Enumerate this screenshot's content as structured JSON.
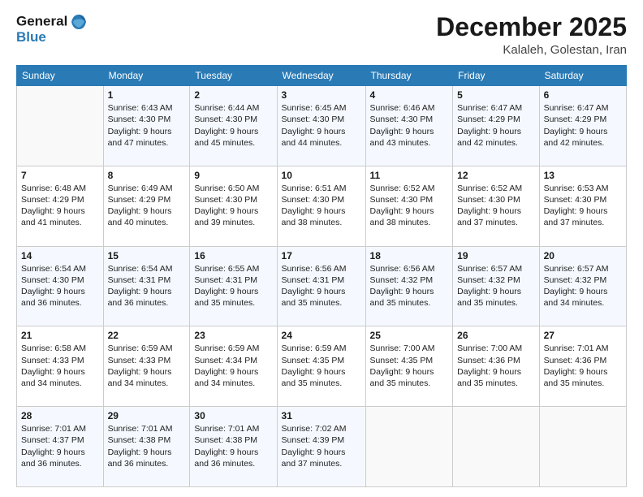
{
  "header": {
    "logo_line1": "General",
    "logo_line2": "Blue",
    "month": "December 2025",
    "location": "Kalaleh, Golestan, Iran"
  },
  "weekdays": [
    "Sunday",
    "Monday",
    "Tuesday",
    "Wednesday",
    "Thursday",
    "Friday",
    "Saturday"
  ],
  "weeks": [
    [
      {
        "day": "",
        "info": ""
      },
      {
        "day": "1",
        "info": "Sunrise: 6:43 AM\nSunset: 4:30 PM\nDaylight: 9 hours\nand 47 minutes."
      },
      {
        "day": "2",
        "info": "Sunrise: 6:44 AM\nSunset: 4:30 PM\nDaylight: 9 hours\nand 45 minutes."
      },
      {
        "day": "3",
        "info": "Sunrise: 6:45 AM\nSunset: 4:30 PM\nDaylight: 9 hours\nand 44 minutes."
      },
      {
        "day": "4",
        "info": "Sunrise: 6:46 AM\nSunset: 4:30 PM\nDaylight: 9 hours\nand 43 minutes."
      },
      {
        "day": "5",
        "info": "Sunrise: 6:47 AM\nSunset: 4:29 PM\nDaylight: 9 hours\nand 42 minutes."
      },
      {
        "day": "6",
        "info": "Sunrise: 6:47 AM\nSunset: 4:29 PM\nDaylight: 9 hours\nand 42 minutes."
      }
    ],
    [
      {
        "day": "7",
        "info": "Sunrise: 6:48 AM\nSunset: 4:29 PM\nDaylight: 9 hours\nand 41 minutes."
      },
      {
        "day": "8",
        "info": "Sunrise: 6:49 AM\nSunset: 4:29 PM\nDaylight: 9 hours\nand 40 minutes."
      },
      {
        "day": "9",
        "info": "Sunrise: 6:50 AM\nSunset: 4:30 PM\nDaylight: 9 hours\nand 39 minutes."
      },
      {
        "day": "10",
        "info": "Sunrise: 6:51 AM\nSunset: 4:30 PM\nDaylight: 9 hours\nand 38 minutes."
      },
      {
        "day": "11",
        "info": "Sunrise: 6:52 AM\nSunset: 4:30 PM\nDaylight: 9 hours\nand 38 minutes."
      },
      {
        "day": "12",
        "info": "Sunrise: 6:52 AM\nSunset: 4:30 PM\nDaylight: 9 hours\nand 37 minutes."
      },
      {
        "day": "13",
        "info": "Sunrise: 6:53 AM\nSunset: 4:30 PM\nDaylight: 9 hours\nand 37 minutes."
      }
    ],
    [
      {
        "day": "14",
        "info": "Sunrise: 6:54 AM\nSunset: 4:30 PM\nDaylight: 9 hours\nand 36 minutes."
      },
      {
        "day": "15",
        "info": "Sunrise: 6:54 AM\nSunset: 4:31 PM\nDaylight: 9 hours\nand 36 minutes."
      },
      {
        "day": "16",
        "info": "Sunrise: 6:55 AM\nSunset: 4:31 PM\nDaylight: 9 hours\nand 35 minutes."
      },
      {
        "day": "17",
        "info": "Sunrise: 6:56 AM\nSunset: 4:31 PM\nDaylight: 9 hours\nand 35 minutes."
      },
      {
        "day": "18",
        "info": "Sunrise: 6:56 AM\nSunset: 4:32 PM\nDaylight: 9 hours\nand 35 minutes."
      },
      {
        "day": "19",
        "info": "Sunrise: 6:57 AM\nSunset: 4:32 PM\nDaylight: 9 hours\nand 35 minutes."
      },
      {
        "day": "20",
        "info": "Sunrise: 6:57 AM\nSunset: 4:32 PM\nDaylight: 9 hours\nand 34 minutes."
      }
    ],
    [
      {
        "day": "21",
        "info": "Sunrise: 6:58 AM\nSunset: 4:33 PM\nDaylight: 9 hours\nand 34 minutes."
      },
      {
        "day": "22",
        "info": "Sunrise: 6:59 AM\nSunset: 4:33 PM\nDaylight: 9 hours\nand 34 minutes."
      },
      {
        "day": "23",
        "info": "Sunrise: 6:59 AM\nSunset: 4:34 PM\nDaylight: 9 hours\nand 34 minutes."
      },
      {
        "day": "24",
        "info": "Sunrise: 6:59 AM\nSunset: 4:35 PM\nDaylight: 9 hours\nand 35 minutes."
      },
      {
        "day": "25",
        "info": "Sunrise: 7:00 AM\nSunset: 4:35 PM\nDaylight: 9 hours\nand 35 minutes."
      },
      {
        "day": "26",
        "info": "Sunrise: 7:00 AM\nSunset: 4:36 PM\nDaylight: 9 hours\nand 35 minutes."
      },
      {
        "day": "27",
        "info": "Sunrise: 7:01 AM\nSunset: 4:36 PM\nDaylight: 9 hours\nand 35 minutes."
      }
    ],
    [
      {
        "day": "28",
        "info": "Sunrise: 7:01 AM\nSunset: 4:37 PM\nDaylight: 9 hours\nand 36 minutes."
      },
      {
        "day": "29",
        "info": "Sunrise: 7:01 AM\nSunset: 4:38 PM\nDaylight: 9 hours\nand 36 minutes."
      },
      {
        "day": "30",
        "info": "Sunrise: 7:01 AM\nSunset: 4:38 PM\nDaylight: 9 hours\nand 36 minutes."
      },
      {
        "day": "31",
        "info": "Sunrise: 7:02 AM\nSunset: 4:39 PM\nDaylight: 9 hours\nand 37 minutes."
      },
      {
        "day": "",
        "info": ""
      },
      {
        "day": "",
        "info": ""
      },
      {
        "day": "",
        "info": ""
      }
    ]
  ]
}
